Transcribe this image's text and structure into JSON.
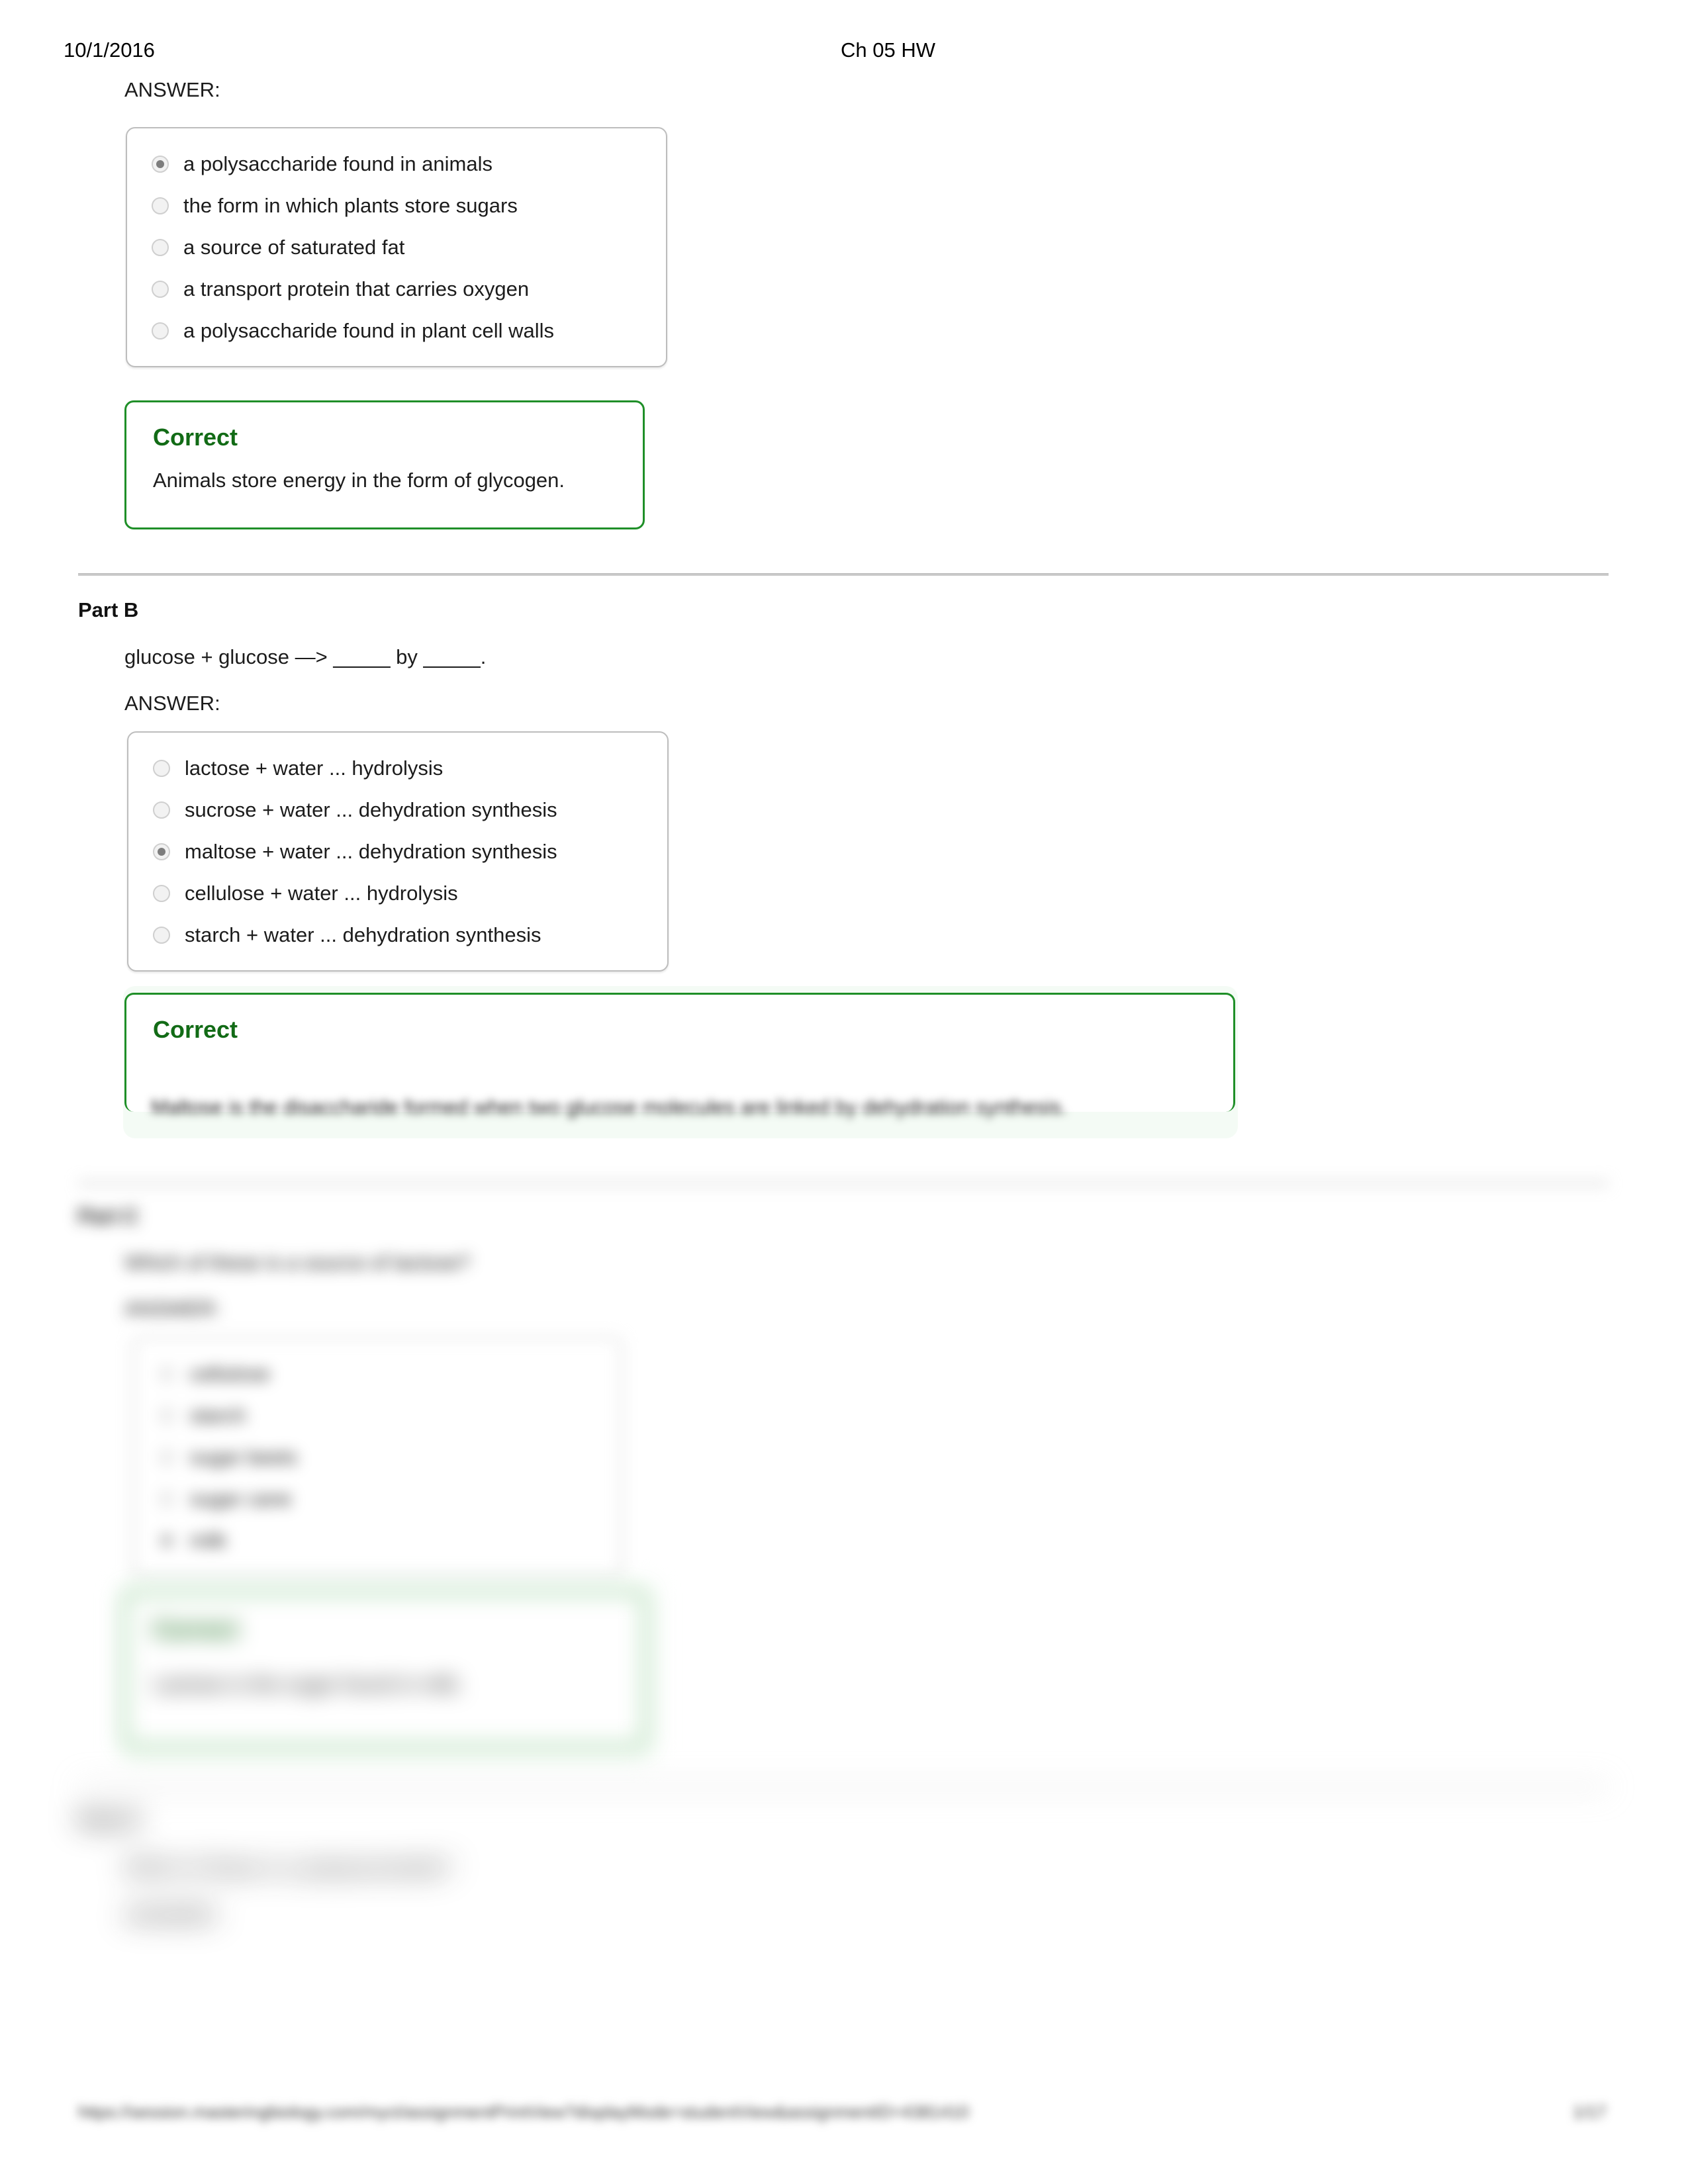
{
  "header": {
    "date": "10/1/2016",
    "title": "Ch 05 HW"
  },
  "labels": {
    "answer": "ANSWER:",
    "correct": "Correct"
  },
  "parts": [
    {
      "id": "part-a",
      "heading": "",
      "question": "",
      "answer_label": "ANSWER:",
      "choices": [
        {
          "text": "a polysaccharide found in animals",
          "selected": true
        },
        {
          "text": "the form in which plants store sugars",
          "selected": false
        },
        {
          "text": "a source of saturated fat",
          "selected": false
        },
        {
          "text": "a transport protein that carries oxygen",
          "selected": false
        },
        {
          "text": "a polysaccharide found in plant cell walls",
          "selected": false
        }
      ],
      "feedback": {
        "title": "Correct",
        "body": "Animals store energy in the form of glycogen."
      }
    },
    {
      "id": "part-b",
      "heading": "Part B",
      "question": "glucose + glucose —> _____ by _____.",
      "answer_label": "ANSWER:",
      "choices": [
        {
          "text": "lactose + water ... hydrolysis",
          "selected": false
        },
        {
          "text": "sucrose + water ... dehydration synthesis",
          "selected": false
        },
        {
          "text": "maltose + water ... dehydration synthesis",
          "selected": true
        },
        {
          "text": "cellulose + water ... hydrolysis",
          "selected": false
        },
        {
          "text": "starch + water ... dehydration synthesis",
          "selected": false
        }
      ],
      "feedback": {
        "title": "Correct",
        "body": "Maltose is the disaccharide formed when two glucose molecules are linked by dehydration synthesis."
      }
    },
    {
      "id": "part-c",
      "heading": "Part C",
      "question": "Which of these is a source of lactose?",
      "answer_label": "ANSWER:",
      "choices": [
        {
          "text": "cellulose",
          "selected": false
        },
        {
          "text": "starch",
          "selected": false
        },
        {
          "text": "sugar beets",
          "selected": false
        },
        {
          "text": "sugar cane",
          "selected": false
        },
        {
          "text": "milk",
          "selected": true
        }
      ],
      "feedback": {
        "title": "Correct",
        "body": "Lactose is the sugar found in milk."
      }
    },
    {
      "id": "part-d",
      "heading": "Part D",
      "question": "Which of these is a polysaccharide?",
      "answer_label": "ANSWER:",
      "choices": [],
      "feedback": null
    }
  ],
  "footer": {
    "url": "https://session.masteringbiology.com/myct/assignmentPrintView?displayMode=studentView&assignmentID=4381410",
    "page": "1/17"
  },
  "colors": {
    "correct_border": "#1f8f28",
    "correct_text": "#126b16",
    "choice_border": "#bdbdbd",
    "divider": "#c9c9c9",
    "radio_dot": "#7d7d7d"
  }
}
